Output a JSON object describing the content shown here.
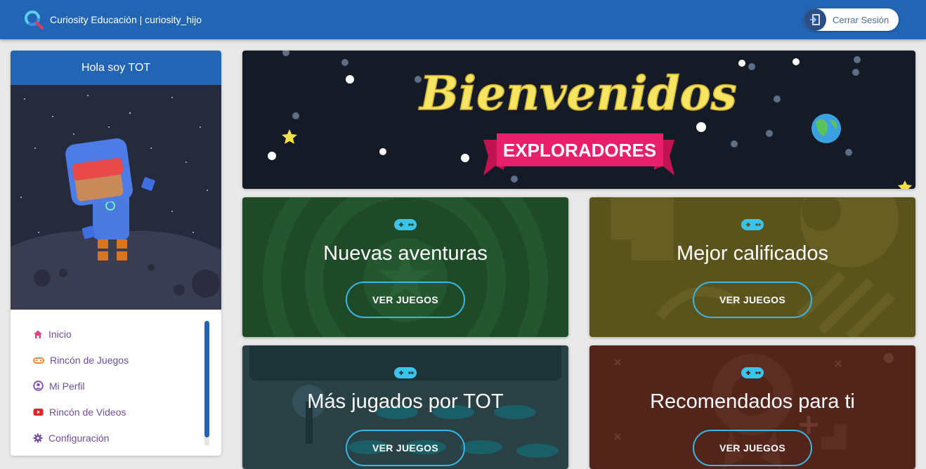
{
  "header": {
    "brand_title": "Curiosity Educación | curiosity_hijo",
    "logout_label": "Cerrar Sesión",
    "color": "#2365b5"
  },
  "sidebar": {
    "greeting": "Hola soy TOT",
    "menu": [
      {
        "label": "Inicio",
        "icon": "home-icon",
        "color": "#e0447c"
      },
      {
        "label": "Rincón de Juegos",
        "icon": "gamepad-icon",
        "color": "#f08a3a"
      },
      {
        "label": "Mi Perfil",
        "icon": "user-circle-icon",
        "color": "#7b4db0"
      },
      {
        "label": "Rincón de Videos",
        "icon": "youtube-icon",
        "color": "#e0262b"
      },
      {
        "label": "Configuración",
        "icon": "gear-icon",
        "color": "#6f4ea0"
      }
    ]
  },
  "banner": {
    "title": "Bienvenidos",
    "ribbon": "EXPLORADORES"
  },
  "cards": [
    {
      "title": "Nuevas aventuras",
      "button": "VER JUEGOS",
      "color": "#1e4a28"
    },
    {
      "title": "Mejor calificados",
      "button": "VER JUEGOS",
      "color": "#5a531c"
    },
    {
      "title": "Más jugados por TOT",
      "button": "VER JUEGOS",
      "color": "#294045"
    },
    {
      "title": "Recomendados para ti",
      "button": "VER JUEGOS",
      "color": "#52241a"
    }
  ]
}
